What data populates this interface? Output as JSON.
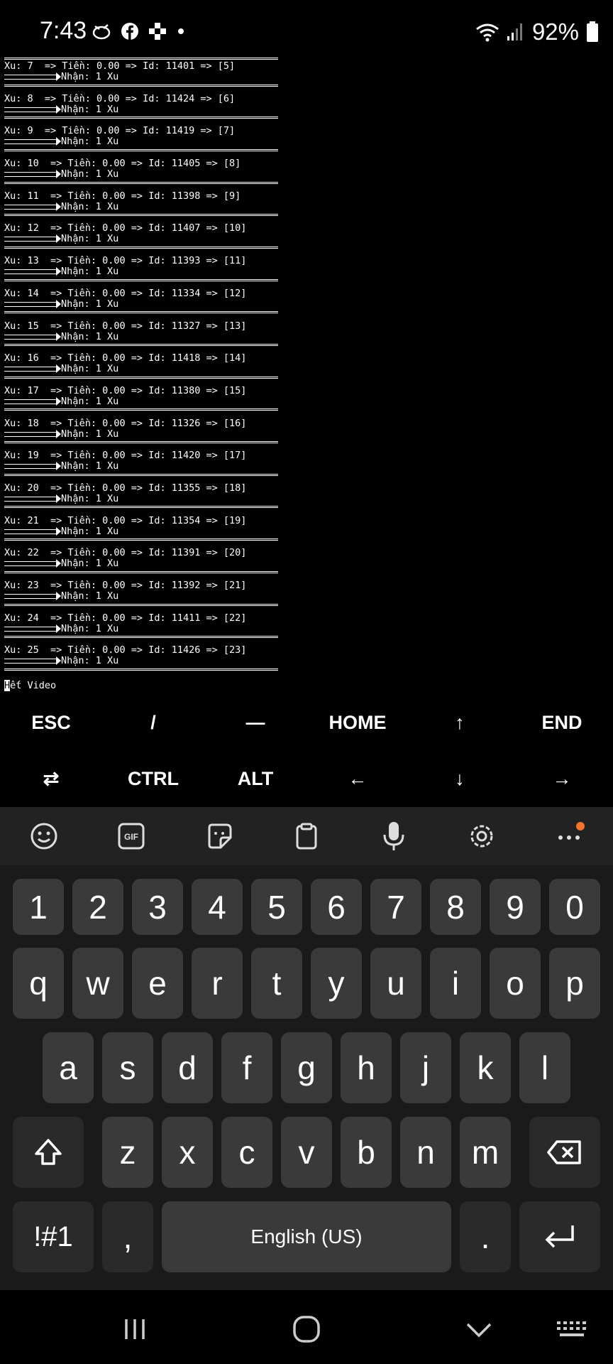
{
  "status": {
    "time": "7:43",
    "battery": "92%",
    "icons_left": [
      "mouse-icon",
      "facebook-icon",
      "game-icon",
      "dot-icon"
    ],
    "icons_right": [
      "wifi-icon",
      "signal-icon",
      "battery-icon"
    ]
  },
  "terminal": {
    "rows": [
      {
        "line": "Xu: 7  => Tiền: 0.00 => Id: 11401 => [5]",
        "sub": "Nhận: 1 Xu"
      },
      {
        "line": "Xu: 8  => Tiền: 0.00 => Id: 11424 => [6]",
        "sub": "Nhận: 1 Xu"
      },
      {
        "line": "Xu: 9  => Tiền: 0.00 => Id: 11419 => [7]",
        "sub": "Nhận: 1 Xu"
      },
      {
        "line": "Xu: 10  => Tiền: 0.00 => Id: 11405 => [8]",
        "sub": "Nhận: 1 Xu"
      },
      {
        "line": "Xu: 11  => Tiền: 0.00 => Id: 11398 => [9]",
        "sub": "Nhận: 1 Xu"
      },
      {
        "line": "Xu: 12  => Tiền: 0.00 => Id: 11407 => [10]",
        "sub": "Nhận: 1 Xu"
      },
      {
        "line": "Xu: 13  => Tiền: 0.00 => Id: 11393 => [11]",
        "sub": "Nhận: 1 Xu"
      },
      {
        "line": "Xu: 14  => Tiền: 0.00 => Id: 11334 => [12]",
        "sub": "Nhận: 1 Xu"
      },
      {
        "line": "Xu: 15  => Tiền: 0.00 => Id: 11327 => [13]",
        "sub": "Nhận: 1 Xu"
      },
      {
        "line": "Xu: 16  => Tiền: 0.00 => Id: 11418 => [14]",
        "sub": "Nhận: 1 Xu"
      },
      {
        "line": "Xu: 17  => Tiền: 0.00 => Id: 11380 => [15]",
        "sub": "Nhận: 1 Xu"
      },
      {
        "line": "Xu: 18  => Tiền: 0.00 => Id: 11326 => [16]",
        "sub": "Nhận: 1 Xu"
      },
      {
        "line": "Xu: 19  => Tiền: 0.00 => Id: 11420 => [17]",
        "sub": "Nhận: 1 Xu"
      },
      {
        "line": "Xu: 20  => Tiền: 0.00 => Id: 11355 => [18]",
        "sub": "Nhận: 1 Xu"
      },
      {
        "line": "Xu: 21  => Tiền: 0.00 => Id: 11354 => [19]",
        "sub": "Nhận: 1 Xu"
      },
      {
        "line": "Xu: 22  => Tiền: 0.00 => Id: 11391 => [20]",
        "sub": "Nhận: 1 Xu"
      },
      {
        "line": "Xu: 23  => Tiền: 0.00 => Id: 11392 => [21]",
        "sub": "Nhận: 1 Xu"
      },
      {
        "line": "Xu: 24  => Tiền: 0.00 => Id: 11411 => [22]",
        "sub": "Nhận: 1 Xu"
      },
      {
        "line": "Xu: 25  => Tiền: 0.00 => Id: 11426 => [23]",
        "sub": "Nhận: 1 Xu"
      }
    ],
    "end_cursor": "H",
    "end_text": "ết Video"
  },
  "extra_keys": {
    "row1": [
      "ESC",
      "/",
      "—",
      "HOME",
      "↑",
      "END"
    ],
    "row2": [
      "⇄",
      "CTRL",
      "ALT",
      "←",
      "↓",
      "→"
    ]
  },
  "keyboard": {
    "toolbar": [
      "emoji-icon",
      "gif-icon",
      "sticker-icon",
      "clipboard-icon",
      "microphone-icon",
      "settings-icon",
      "more-icon"
    ],
    "gif_label": "GIF",
    "row_numbers": [
      "1",
      "2",
      "3",
      "4",
      "5",
      "6",
      "7",
      "8",
      "9",
      "0"
    ],
    "row_q": [
      "q",
      "w",
      "e",
      "r",
      "t",
      "y",
      "u",
      "i",
      "o",
      "p"
    ],
    "row_a": [
      "a",
      "s",
      "d",
      "f",
      "g",
      "h",
      "j",
      "k",
      "l"
    ],
    "row_z": [
      "z",
      "x",
      "c",
      "v",
      "b",
      "n",
      "m"
    ],
    "symbols": "!#1",
    "comma": ",",
    "space": "English (US)",
    "period": "."
  },
  "nav": [
    "recents-icon",
    "home-icon",
    "back-icon",
    "keyboard-hide-icon"
  ],
  "colors": {
    "background": "#000000",
    "key": "#3a3a3a",
    "toolbar": "#222222",
    "badge": "#f07530"
  }
}
